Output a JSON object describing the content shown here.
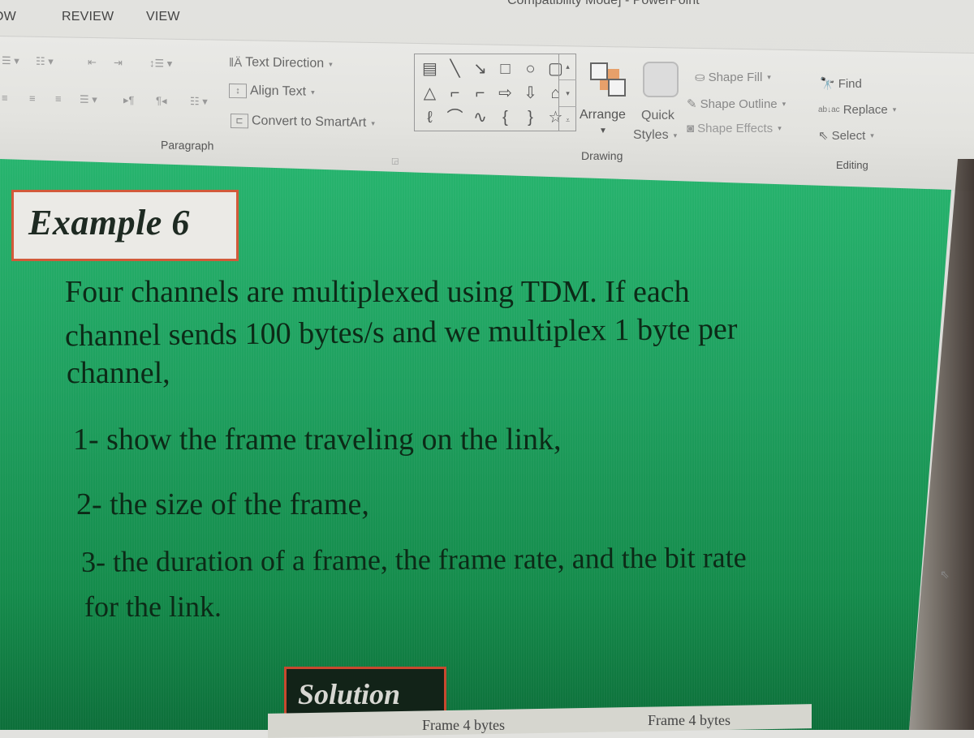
{
  "window": {
    "title_fragment": "Compatibility Mode] - PowerPoint"
  },
  "tabs": [
    {
      "label": "VIEW"
    },
    {
      "label": "REVIEW"
    },
    {
      "label": "SLIDE SHOW"
    }
  ],
  "ribbon": {
    "paragraph": {
      "label": "Paragraph",
      "text_direction": "Text Direction",
      "align_text": "Align Text",
      "convert_smartart": "Convert to SmartArt"
    },
    "drawing": {
      "label": "Drawing",
      "shapes": [
        "▤",
        "╲",
        "↘",
        "□",
        "○",
        "▢",
        "△",
        "⌐",
        "⌐",
        "⇨",
        "⇩",
        "⌂",
        "ℓ",
        "⌒",
        "∿",
        "{",
        "}",
        "☆"
      ],
      "arrange": "Arrange",
      "quick_styles_1": "Quick",
      "quick_styles_2": "Styles",
      "shape_fill": "Shape Fill",
      "shape_outline": "Shape Outline",
      "shape_effects": "Shape Effects"
    },
    "editing": {
      "label": "Editing",
      "find": "Find",
      "replace": "Replace",
      "select": "Select"
    }
  },
  "slide": {
    "heading": "Example 6",
    "intro_lines": [
      "Four channels are multiplexed using TDM. If each",
      "channel sends 100 bytes/s and we multiplex 1 byte per",
      "channel,"
    ],
    "item1": "1- show the frame traveling on the link,",
    "item2": "2- the size of the frame,",
    "item3_lines": [
      "3- the duration of a frame, the frame rate, and the bit rate",
      "for the link."
    ],
    "solution": "Solution",
    "frame_label_1": "Frame  4 bytes",
    "frame_label_2": "Frame  4 bytes"
  },
  "colors": {
    "slide_green": "#27b46e",
    "box_border": "#d25a3a",
    "text_dark": "#0c2a17"
  }
}
